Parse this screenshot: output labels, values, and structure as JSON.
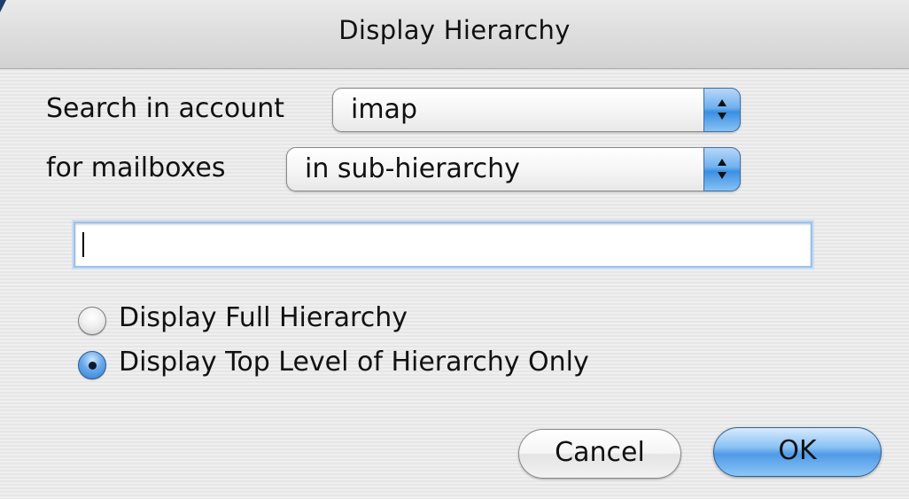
{
  "dialog": {
    "title": "Display Hierarchy"
  },
  "search": {
    "account_label": "Search in account",
    "account_value": "imap",
    "mailboxes_label": "for mailboxes",
    "mailboxes_value": "in sub-hierarchy",
    "text_value": ""
  },
  "options": [
    {
      "label": "Display Full Hierarchy",
      "selected": false
    },
    {
      "label": "Display Top Level of  Hierarchy Only",
      "selected": true
    }
  ],
  "buttons": {
    "cancel_label": "Cancel",
    "ok_label": "OK"
  },
  "icons": {
    "popup_arrows": "up-down-arrows-icon",
    "corner": "window-corner-icon"
  },
  "colors": {
    "accent_blue": "#4f9ae6",
    "focus_ring": "#9ec1ea",
    "background": "#ececec"
  }
}
